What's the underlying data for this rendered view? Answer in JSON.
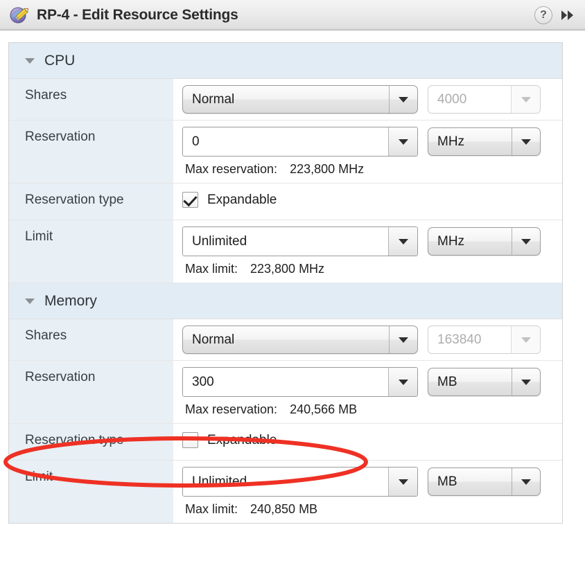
{
  "window": {
    "title": "RP-4 - Edit Resource Settings",
    "app_icon": "resource-pool-edit-icon",
    "help_label": "?",
    "collapse_icon": "double-chevron-right-icon"
  },
  "sections": [
    {
      "id": "cpu",
      "title": "CPU",
      "expanded": true,
      "toggle_icon": "triangle-down-icon",
      "rows": [
        {
          "type": "shares",
          "label": "Shares",
          "combo_value": "Normal",
          "stepper_value": "4000",
          "stepper_disabled": true
        },
        {
          "type": "reservation",
          "label": "Reservation",
          "input_value": "0",
          "unit_value": "MHz",
          "hint_label": "Max reservation:",
          "hint_value": "223,800 MHz"
        },
        {
          "type": "reservation_type",
          "label": "Reservation type",
          "checkbox_label": "Expandable",
          "checked": true
        },
        {
          "type": "limit",
          "label": "Limit",
          "input_value": "Unlimited",
          "unit_value": "MHz",
          "hint_label": "Max limit:",
          "hint_value": "223,800 MHz"
        }
      ]
    },
    {
      "id": "memory",
      "title": "Memory",
      "expanded": true,
      "toggle_icon": "triangle-down-icon",
      "rows": [
        {
          "type": "shares",
          "label": "Shares",
          "combo_value": "Normal",
          "stepper_value": "163840",
          "stepper_disabled": true
        },
        {
          "type": "reservation",
          "label": "Reservation",
          "input_value": "300",
          "unit_value": "MB",
          "hint_label": "Max reservation:",
          "hint_value": "240,566 MB"
        },
        {
          "type": "reservation_type",
          "label": "Reservation type",
          "checkbox_label": "Expandable",
          "checked": false
        },
        {
          "type": "limit",
          "label": "Limit",
          "input_value": "Unlimited",
          "unit_value": "MB",
          "hint_label": "Max limit:",
          "hint_value": "240,850 MB"
        }
      ]
    }
  ],
  "annotation": {
    "shape": "ellipse",
    "color": "#ee3124",
    "targets": "memory-reservation-type-row"
  }
}
